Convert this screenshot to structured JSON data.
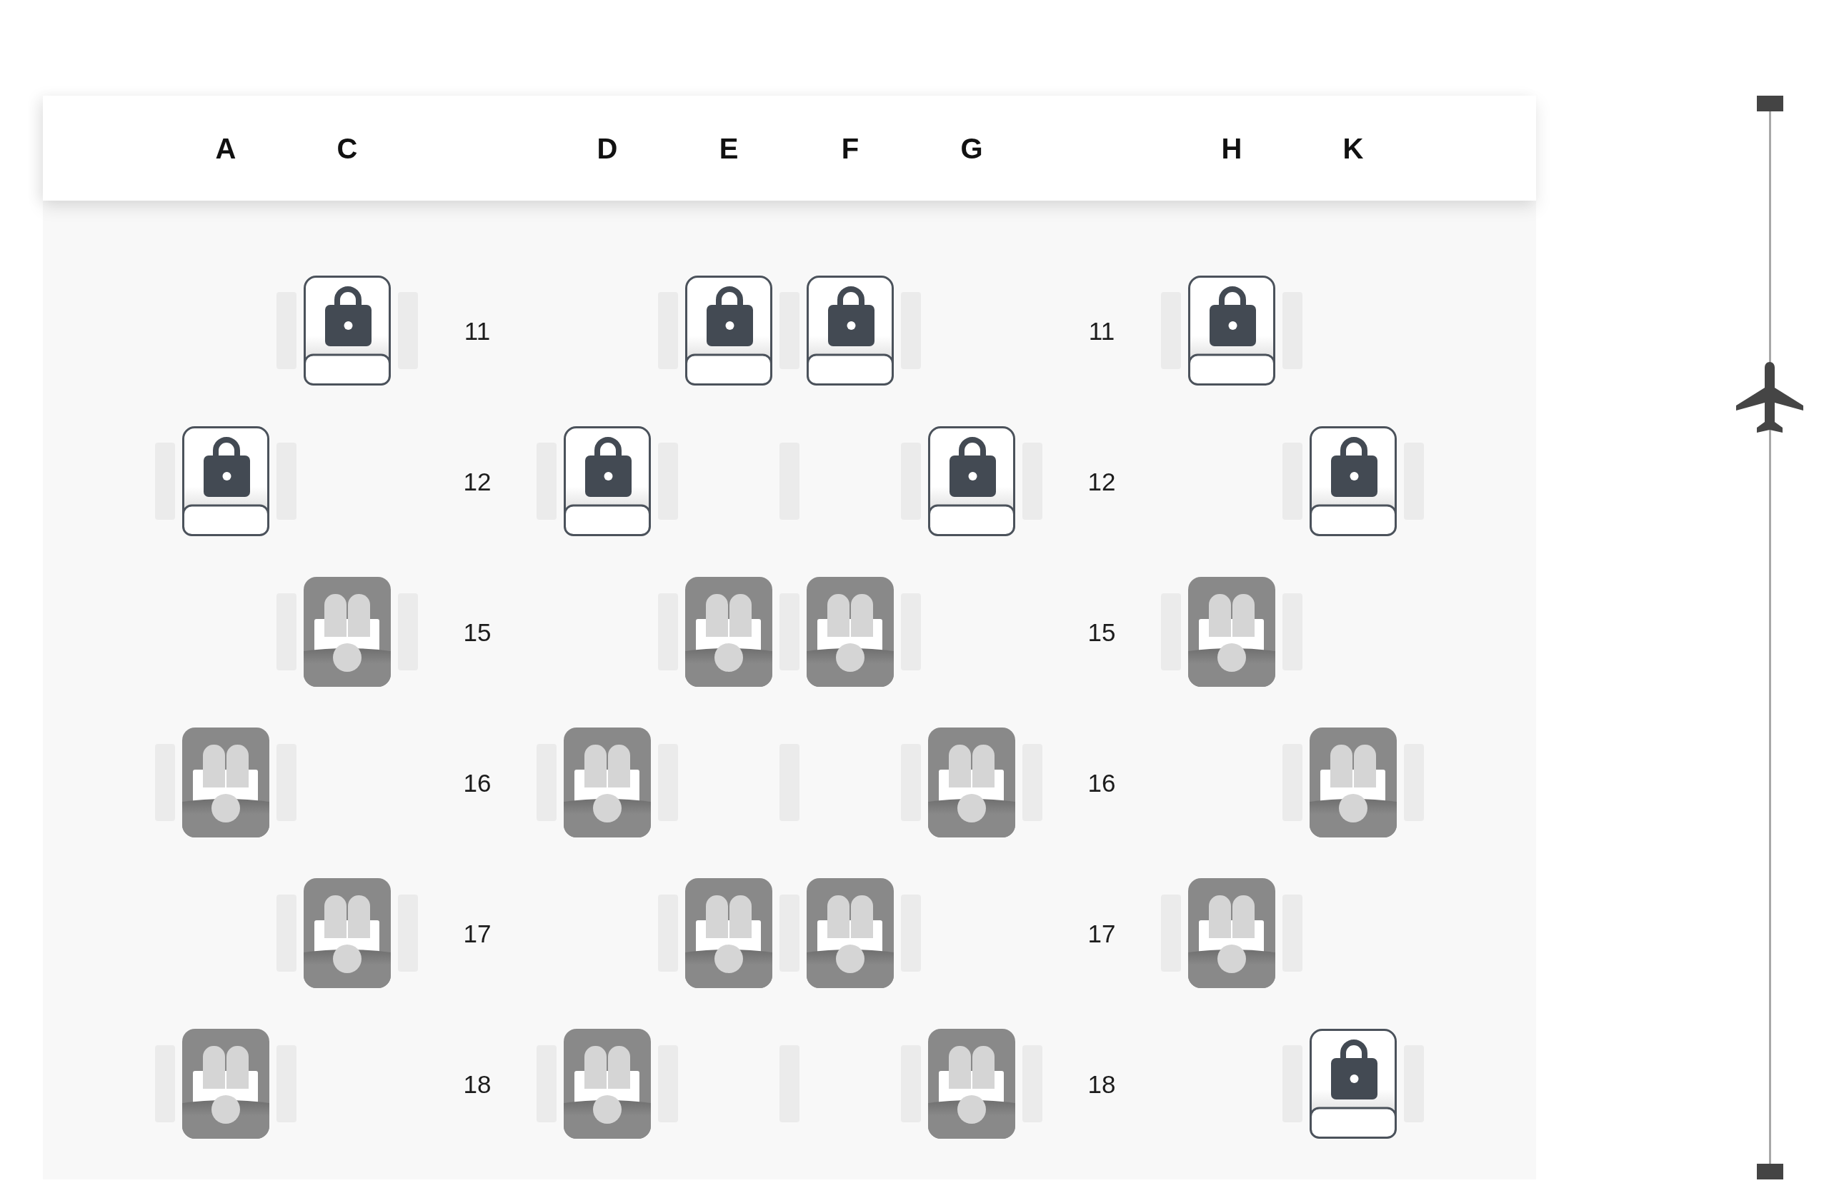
{
  "seat_map": {
    "column_header": {
      "sections": [
        {
          "letters": [
            "A",
            "C"
          ]
        },
        {
          "letters": [
            "D",
            "E",
            "F",
            "G"
          ]
        },
        {
          "letters": [
            "H",
            "K"
          ]
        }
      ]
    },
    "rows": [
      {
        "aisle_labels": [
          "11",
          "11"
        ],
        "sections": [
          {
            "seats": [
              {
                "kind": "gap"
              },
              {
                "kind": "locked"
              }
            ]
          },
          {
            "seats": [
              {
                "kind": "gap"
              },
              {
                "kind": "locked"
              },
              {
                "kind": "locked"
              },
              {
                "kind": "gap"
              }
            ]
          },
          {
            "seats": [
              {
                "kind": "locked"
              },
              {
                "kind": "gap"
              }
            ]
          }
        ]
      },
      {
        "aisle_labels": [
          "12",
          "12"
        ],
        "sections": [
          {
            "seats": [
              {
                "kind": "locked"
              },
              {
                "kind": "gap"
              }
            ]
          },
          {
            "seats": [
              {
                "kind": "locked"
              },
              {
                "kind": "gap"
              },
              {
                "kind": "gap"
              },
              {
                "kind": "locked"
              }
            ]
          },
          {
            "seats": [
              {
                "kind": "gap"
              },
              {
                "kind": "locked"
              }
            ]
          }
        ]
      },
      {
        "aisle_labels": [
          "15",
          "15"
        ],
        "sections": [
          {
            "seats": [
              {
                "kind": "gap"
              },
              {
                "kind": "occupied"
              }
            ]
          },
          {
            "seats": [
              {
                "kind": "gap"
              },
              {
                "kind": "occupied"
              },
              {
                "kind": "occupied"
              },
              {
                "kind": "gap"
              }
            ]
          },
          {
            "seats": [
              {
                "kind": "occupied"
              },
              {
                "kind": "gap"
              }
            ]
          }
        ]
      },
      {
        "aisle_labels": [
          "16",
          "16"
        ],
        "sections": [
          {
            "seats": [
              {
                "kind": "occupied"
              },
              {
                "kind": "gap"
              }
            ]
          },
          {
            "seats": [
              {
                "kind": "occupied"
              },
              {
                "kind": "gap"
              },
              {
                "kind": "gap"
              },
              {
                "kind": "occupied"
              }
            ]
          },
          {
            "seats": [
              {
                "kind": "gap"
              },
              {
                "kind": "occupied"
              }
            ]
          }
        ]
      },
      {
        "aisle_labels": [
          "17",
          "17"
        ],
        "sections": [
          {
            "seats": [
              {
                "kind": "gap"
              },
              {
                "kind": "occupied"
              }
            ]
          },
          {
            "seats": [
              {
                "kind": "gap"
              },
              {
                "kind": "occupied"
              },
              {
                "kind": "occupied"
              },
              {
                "kind": "gap"
              }
            ]
          },
          {
            "seats": [
              {
                "kind": "occupied"
              },
              {
                "kind": "gap"
              }
            ]
          }
        ]
      },
      {
        "aisle_labels": [
          "18",
          "18"
        ],
        "sections": [
          {
            "seats": [
              {
                "kind": "occupied"
              },
              {
                "kind": "gap"
              }
            ]
          },
          {
            "seats": [
              {
                "kind": "occupied"
              },
              {
                "kind": "gap"
              },
              {
                "kind": "gap"
              },
              {
                "kind": "occupied"
              }
            ]
          },
          {
            "seats": [
              {
                "kind": "gap"
              },
              {
                "kind": "locked"
              }
            ]
          }
        ]
      }
    ]
  }
}
